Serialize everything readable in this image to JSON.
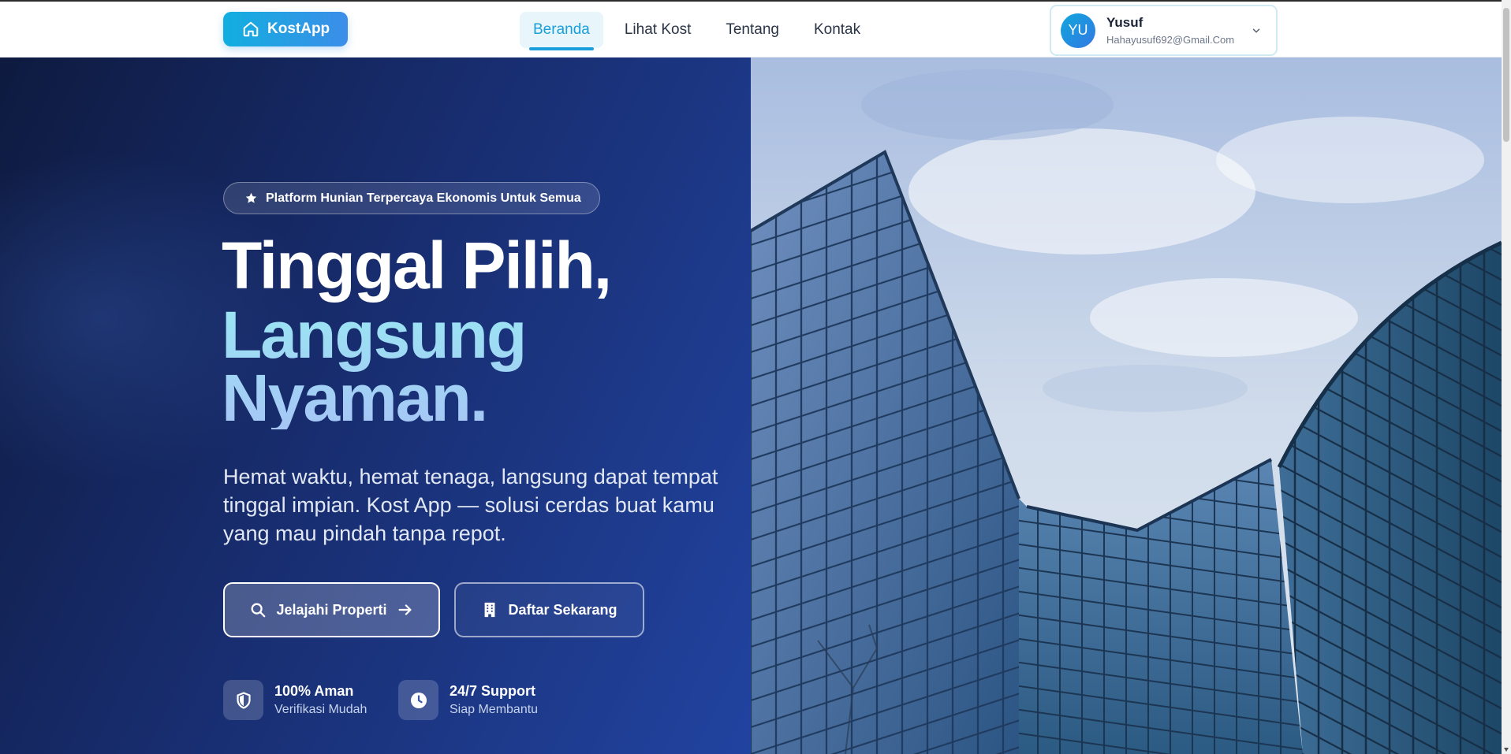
{
  "brand": {
    "name": "KostApp",
    "icon": "home-icon"
  },
  "nav": {
    "items": [
      {
        "label": "Beranda",
        "active": true
      },
      {
        "label": "Lihat Kost",
        "active": false
      },
      {
        "label": "Tentang",
        "active": false
      },
      {
        "label": "Kontak",
        "active": false
      }
    ]
  },
  "user": {
    "initials": "YU",
    "name": "Yusuf",
    "email": "Hahayusuf692@Gmail.Com",
    "menu_icon": "chevron-down-icon"
  },
  "hero": {
    "badge": {
      "icon": "star-icon",
      "text": "Platform Hunian Terpercaya Ekonomis Untuk Semua"
    },
    "title_line1": "Tinggal Pilih,",
    "title_line2": "Langsung Nyaman.",
    "description": "Hemat waktu, hemat tenaga, langsung dapat tempat tinggal impian. Kost App — solusi cerdas buat kamu yang mau pindah tanpa repot.",
    "primary_button": {
      "label": "Jelajahi Properti",
      "icon": "search-icon",
      "trailing_icon": "arrow-right-icon"
    },
    "secondary_button": {
      "label": "Daftar Sekarang",
      "icon": "building-icon"
    },
    "features": [
      {
        "icon": "shield-icon",
        "title": "100% Aman",
        "subtitle": "Verifikasi Mudah"
      },
      {
        "icon": "clock-icon",
        "title": "24/7 Support",
        "subtitle": "Siap Membantu"
      }
    ]
  },
  "colors": {
    "accent": "#1aa0d8",
    "brand_gradient_start": "#12aee0",
    "brand_gradient_end": "#3c8ee8",
    "hero_dark": "#0e1a3f",
    "hero_mid": "#2143a0",
    "headline_highlight": "#9ae6f4"
  }
}
